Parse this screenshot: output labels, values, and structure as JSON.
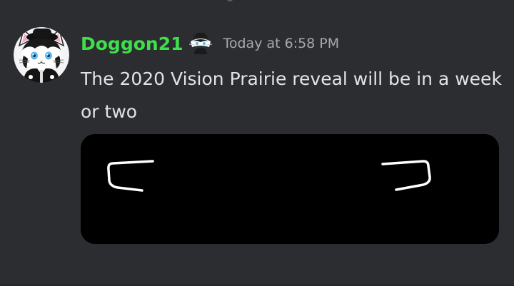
{
  "message": {
    "author": "Doggon21",
    "timestamp": "Today at 6:58 PM",
    "text": "The 2020 Vision Prairie reveal will be in a week or two",
    "avatar_icon": "cat-avatar-icon",
    "badge_icon": "cat-badge-icon",
    "embed": {
      "type": "image",
      "description_icons": [
        "left-headlight-icon",
        "right-headlight-icon"
      ]
    }
  },
  "colors": {
    "background": "#2b2d31",
    "username": "#3ee04a",
    "text": "#e2e3e6",
    "timestamp": "#a7a9ae",
    "embed_bg": "#000000"
  }
}
